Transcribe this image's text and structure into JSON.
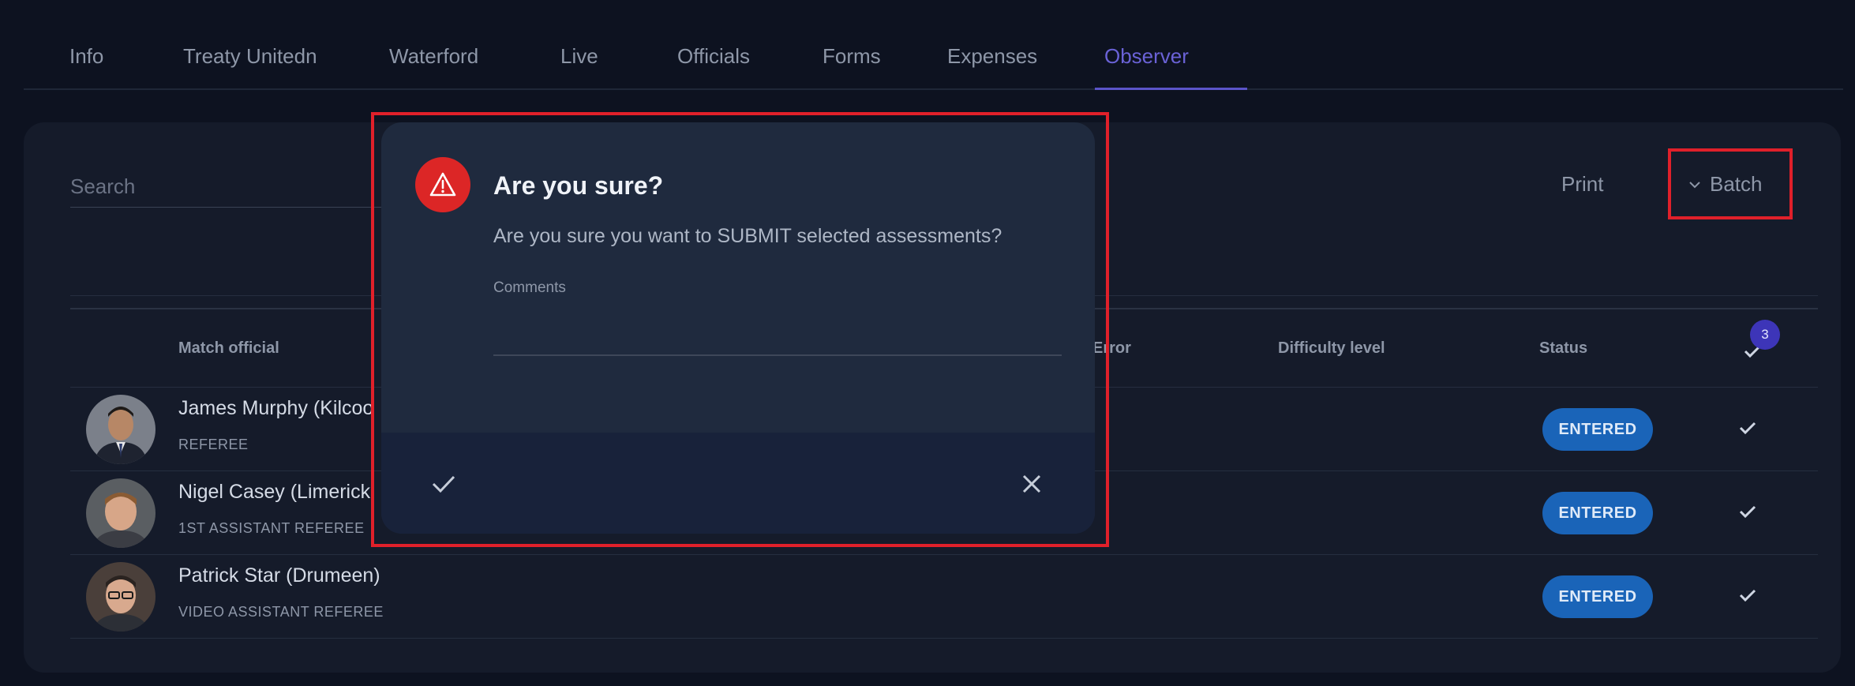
{
  "tabs": [
    {
      "label": "Info"
    },
    {
      "label": "Treaty Unitedn"
    },
    {
      "label": "Waterford"
    },
    {
      "label": "Live"
    },
    {
      "label": "Officials"
    },
    {
      "label": "Forms"
    },
    {
      "label": "Expenses"
    },
    {
      "label": "Observer"
    }
  ],
  "active_tab": "Observer",
  "toolbar": {
    "search_placeholder": "Search",
    "print_label": "Print",
    "batch_label": "Batch"
  },
  "table": {
    "headers": {
      "match_official": "Match official",
      "error": "Error",
      "difficulty": "Difficulty level",
      "status": "Status"
    },
    "selected_count": "3",
    "rows": [
      {
        "name": "James Murphy (Kilcoo",
        "role": "REFEREE",
        "status": "ENTERED"
      },
      {
        "name": "Nigel Casey (Limerick",
        "role": "1ST ASSISTANT REFEREE",
        "status": "ENTERED"
      },
      {
        "name": "Patrick Star (Drumeen)",
        "role": "VIDEO ASSISTANT REFEREE",
        "status": "ENTERED"
      }
    ]
  },
  "dialog": {
    "title": "Are you sure?",
    "message": "Are you sure you want to SUBMIT selected assessments?",
    "comments_label": "Comments",
    "comments_value": ""
  },
  "colors": {
    "accent": "#5b54c9",
    "status_entered": "#1a64b8",
    "warning": "#dc2626",
    "highlight": "#e0202a"
  }
}
